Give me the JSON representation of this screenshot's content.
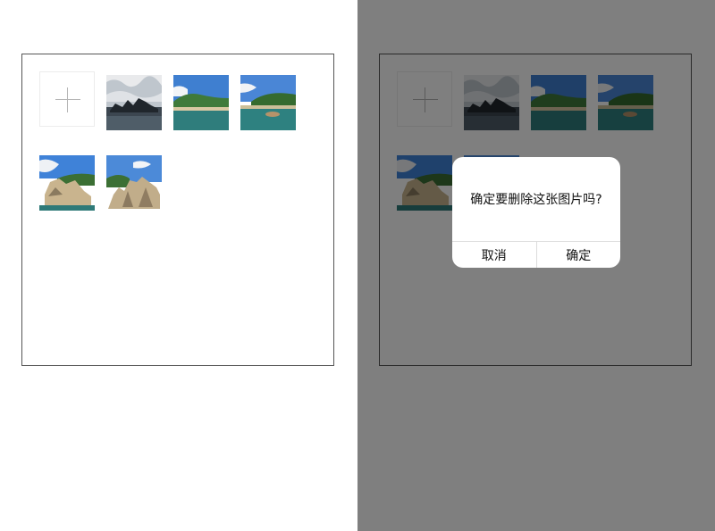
{
  "confirm_dialog": {
    "message": "确定要删除这张图片吗?",
    "cancel_label": "取消",
    "confirm_label": "确定"
  },
  "gallery": {
    "add_icon": "plus-icon",
    "photos": [
      "rock-formation-cloudy",
      "green-island-beach",
      "island-rocks-boat",
      "beach-boulders",
      "granite-rocks-coast"
    ]
  },
  "colors": {
    "overlay": "#808080",
    "dialog_bg": "#ffffff",
    "frame_border": "#555555"
  }
}
